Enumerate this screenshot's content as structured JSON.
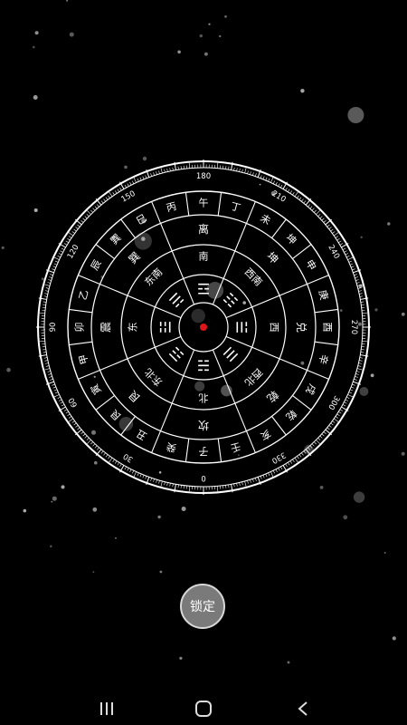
{
  "compass": {
    "degree_labels": [
      "0",
      "30",
      "60",
      "90",
      "120",
      "150",
      "180",
      "210",
      "240",
      "270",
      "300",
      "330"
    ],
    "earthly_branch_ring": [
      "子",
      "癸",
      "丑",
      "艮",
      "寅",
      "甲",
      "卯",
      "乙",
      "辰",
      "巽",
      "巳",
      "丙",
      "午",
      "丁",
      "未",
      "坤",
      "申",
      "庚",
      "酉",
      "辛",
      "戌",
      "乾",
      "亥",
      "壬"
    ],
    "trigram_ring": [
      "坎",
      "艮",
      "震",
      "巽",
      "离",
      "坤",
      "兑",
      "乾"
    ],
    "direction_ring": [
      "北",
      "东北",
      "东",
      "东南",
      "南",
      "西南",
      "西",
      "西北"
    ],
    "trigram_symbols": [
      "☵",
      "☶",
      "☳",
      "☴",
      "☲",
      "☷",
      "☱",
      "☰"
    ],
    "needle_color": "#e0141b"
  },
  "lock_button": {
    "label": "锁定"
  },
  "navbar": {
    "recents_icon": "recents-icon",
    "home_icon": "home-icon",
    "back_icon": "back-icon"
  },
  "colors": {
    "background": "#000000",
    "lines": "#ffffff",
    "button_fill": "#7a7a7a"
  }
}
